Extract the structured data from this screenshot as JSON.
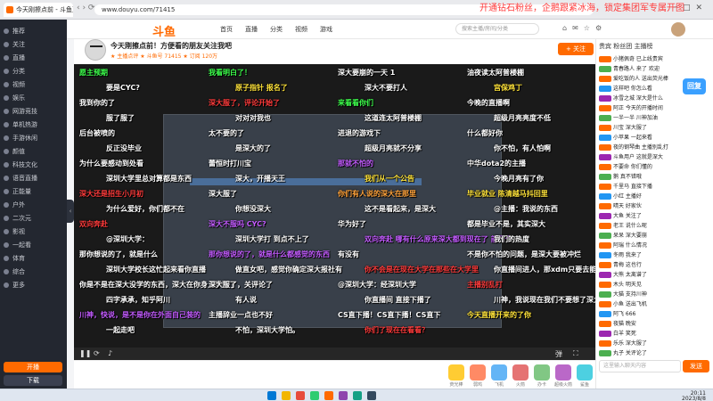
{
  "browser": {
    "tab_title": "今天刚擦点前 - 斗鱼直播",
    "url": "www.douyu.com/71415",
    "overlay_caption": "开通钻石粉丝，企鹅跟紧冰海，锁定集团军专属开图"
  },
  "sidebar": {
    "items": [
      {
        "label": "推荐"
      },
      {
        "label": "关注"
      },
      {
        "label": "直播"
      },
      {
        "label": "分类"
      },
      {
        "label": "视频"
      },
      {
        "label": "娱乐"
      },
      {
        "label": "网游竞技"
      },
      {
        "label": "单机热游"
      },
      {
        "label": "手游休闲"
      },
      {
        "label": "颜值"
      },
      {
        "label": "科技文化"
      },
      {
        "label": "语音直播"
      },
      {
        "label": "正能量"
      },
      {
        "label": "户外"
      },
      {
        "label": "二次元"
      },
      {
        "label": "影视"
      },
      {
        "label": "一起看"
      },
      {
        "label": "体育"
      },
      {
        "label": "综合"
      },
      {
        "label": "更多"
      }
    ],
    "btn_primary": "开播",
    "btn_secondary": "下载"
  },
  "nav": {
    "logo": "斗鱼",
    "links": [
      "首页",
      "直播",
      "分类",
      "视频",
      "游戏"
    ],
    "search_placeholder": "搜索主播/房间/分类"
  },
  "room": {
    "title": "今天刚擦点前！方便看的朋友关注我吧",
    "meta": "★ 主播点评  ★ 斗鱼号 71415  ★ 订阅 120万",
    "follow_label": "+ 关注"
  },
  "danmu": [
    {
      "text": "愿主预期",
      "cls": "c-green"
    },
    {
      "text": "我看明白了！",
      "cls": "c-green"
    },
    {
      "text": "深大要崩的一天 1",
      "cls": "c-white"
    },
    {
      "text": "油夜读太阿普楼棚",
      "cls": "c-white"
    },
    {
      "text": "要是CYC?",
      "cls": "c-white"
    },
    {
      "text": "原子指针 报名了",
      "cls": "c-yellow"
    },
    {
      "text": "深大不要打人",
      "cls": "c-white"
    },
    {
      "text": "宫保鸡丁",
      "cls": "c-yellow"
    },
    {
      "text": "我到你的了",
      "cls": "c-white"
    },
    {
      "text": "深大服了，评论开始了",
      "cls": "c-red"
    },
    {
      "text": "来看看你们",
      "cls": "c-green"
    },
    {
      "text": "今晚的直播啊",
      "cls": "c-white"
    },
    {
      "text": "服了服了",
      "cls": "c-white"
    },
    {
      "text": "对对对我也",
      "cls": "c-white"
    },
    {
      "text": "这道连太阿普楼棚",
      "cls": "c-white"
    },
    {
      "text": "超级月亮亮度不低",
      "cls": "c-white"
    },
    {
      "text": "后台被喷的",
      "cls": "c-white"
    },
    {
      "text": "太不要的了",
      "cls": "c-white"
    },
    {
      "text": "进退的游戏下",
      "cls": "c-white"
    },
    {
      "text": "什么都好你",
      "cls": "c-white"
    },
    {
      "text": "反正没毕业",
      "cls": "c-white"
    },
    {
      "text": "是深大的了",
      "cls": "c-white"
    },
    {
      "text": "超级月亮就不分享",
      "cls": "c-white"
    },
    {
      "text": "你不怕，有人怕啊",
      "cls": "c-white"
    },
    {
      "text": "为什么要感动到处看",
      "cls": "c-white"
    },
    {
      "text": "蕾恒时打川宝",
      "cls": "c-white"
    },
    {
      "text": "那就不怕的",
      "cls": "c-purple"
    },
    {
      "text": "中华dota2的主播",
      "cls": "c-white"
    },
    {
      "text": "深圳大学里总对算都是东西",
      "cls": "c-white"
    },
    {
      "text": "深大，开播天王",
      "cls": "c-white"
    },
    {
      "text": "我们从一个公告",
      "cls": "c-yellow"
    },
    {
      "text": "今晚月亮有了你",
      "cls": "c-white"
    },
    {
      "text": "深大还是招生小月初",
      "cls": "c-red"
    },
    {
      "text": "深大服了",
      "cls": "c-white"
    },
    {
      "text": "你们有人说的深大在那里",
      "cls": "c-orange"
    },
    {
      "text": "毕业就业 陈清越马抖回里",
      "cls": "c-yellow"
    },
    {
      "text": "为什么爱好，你们都不在",
      "cls": "c-white"
    },
    {
      "text": "你想没深大",
      "cls": "c-white"
    },
    {
      "text": "这不是看起来，是深大",
      "cls": "c-white"
    },
    {
      "text": "@主播：我说的东西",
      "cls": "c-white"
    },
    {
      "text": "双向奔赴",
      "cls": "c-red"
    },
    {
      "text": "深大不服吗 CYC?",
      "cls": "c-purple"
    },
    {
      "text": "华为好了",
      "cls": "c-white"
    },
    {
      "text": "都是毕业不是，其实深大",
      "cls": "c-white"
    },
    {
      "text": "@深圳大学：",
      "cls": "c-white"
    },
    {
      "text": "深圳大学打 到点不上了",
      "cls": "c-white"
    },
    {
      "text": "双向奔赴 哪有什么原来深大都到现在了 前几个",
      "cls": "c-purple"
    },
    {
      "text": "我们的热度",
      "cls": "c-white"
    },
    {
      "text": "那你想说的了，就是什么",
      "cls": "c-white"
    },
    {
      "text": "那你想说的了，就是什么都感觉的东西",
      "cls": "c-purple"
    },
    {
      "text": "有没有",
      "cls": "c-white"
    },
    {
      "text": "不是你不怕的问题，是深大要被冲烂",
      "cls": "c-white"
    },
    {
      "text": "深圳大学校长这忙起来看你直播",
      "cls": "c-white"
    },
    {
      "text": "做直女吧，感觉你确定深大报社有",
      "cls": "c-white"
    },
    {
      "text": "你不会是在现在大学在那些在大学里",
      "cls": "c-red"
    },
    {
      "text": "你直播间进人，那xdm只要去能摸了",
      "cls": "c-white"
    },
    {
      "text": "你是不是在深大没学的东西，深大在你身上学到了",
      "cls": "c-white"
    },
    {
      "text": "深大服了，关评论了",
      "cls": "c-white"
    },
    {
      "text": "@深圳大学：经深圳大学",
      "cls": "c-white"
    },
    {
      "text": "主播别乱打",
      "cls": "c-red"
    },
    {
      "text": "四字承承，知乎阿川",
      "cls": "c-white"
    },
    {
      "text": "有人说",
      "cls": "c-white"
    },
    {
      "text": "你直播间 直接下播了",
      "cls": "c-white"
    },
    {
      "text": "川神，我说现在我们不要想了深大，我没在这里",
      "cls": "c-white"
    },
    {
      "text": "川神，快说，是不是你在外面自己装的",
      "cls": "c-purple"
    },
    {
      "text": "主播辞业一点也不好",
      "cls": "c-white"
    },
    {
      "text": "CS直下播！CS直下播！CS直下",
      "cls": "c-white"
    },
    {
      "text": "今天直播开来的了你",
      "cls": "c-yellow"
    },
    {
      "text": "一起走吧",
      "cls": "c-white"
    },
    {
      "text": "不怕，深圳大学怕。",
      "cls": "c-white"
    },
    {
      "text": "你们了现在在看看？",
      "cls": "c-red"
    }
  ],
  "gifts": [
    {
      "label": "荧光棒"
    },
    {
      "label": "弱鸡"
    },
    {
      "label": "飞机"
    },
    {
      "label": "火箭"
    },
    {
      "label": "办卡"
    },
    {
      "label": "超级火箭"
    },
    {
      "label": "鲨鱼"
    }
  ],
  "right_panel": {
    "tabs": "贵宾  粉丝团  主播榜",
    "rows": [
      {
        "text": "小猪佩奇  已上线贵宾",
        "badge": "#ff6a00"
      },
      {
        "text": "青春路人 来了 欢迎",
        "badge": "#4caf50"
      },
      {
        "text": "爱吃饭的人 送出荧光棒",
        "badge": "#ff6a00"
      },
      {
        "text": "这样吧 你怎么看",
        "badge": "#2196f3"
      },
      {
        "text": "冰雪之城 深大是什么",
        "badge": "#9c27b0"
      },
      {
        "text": "阿正 今天的开播时间",
        "badge": "#ff6a00"
      },
      {
        "text": "一半一半 川神加油",
        "badge": "#4caf50"
      },
      {
        "text": "川宝 深大服了",
        "badge": "#ff6a00"
      },
      {
        "text": "小苹果 一起来看",
        "badge": "#2196f3"
      },
      {
        "text": "夜的钢琴曲 主播别乱打",
        "badge": "#ff6a00"
      },
      {
        "text": "斗鱼用户 这就是深大",
        "badge": "#9c27b0"
      },
      {
        "text": "不要命 你们懂的",
        "badge": "#ff6a00"
      },
      {
        "text": "鹅 真不错哦",
        "badge": "#4caf50"
      },
      {
        "text": "千里马 直接下播",
        "badge": "#ff6a00"
      },
      {
        "text": "小红 主播好",
        "badge": "#2196f3"
      },
      {
        "text": "晴天 好家伙",
        "badge": "#ff6a00"
      },
      {
        "text": "大鱼 关注了",
        "badge": "#9c27b0"
      },
      {
        "text": "老王 说什么呢",
        "badge": "#ff6a00"
      },
      {
        "text": "呆呆 深大要崩",
        "badge": "#4caf50"
      },
      {
        "text": "阿瑞 什么情况",
        "badge": "#ff6a00"
      },
      {
        "text": "冬雨 我来了",
        "badge": "#2196f3"
      },
      {
        "text": "青梅 这也行",
        "badge": "#ff6a00"
      },
      {
        "text": "大熊 太离谱了",
        "badge": "#9c27b0"
      },
      {
        "text": "木头 明天见",
        "badge": "#ff6a00"
      },
      {
        "text": "大猫 支持川神",
        "badge": "#4caf50"
      },
      {
        "text": "小鱼 送出飞机",
        "badge": "#ff6a00"
      },
      {
        "text": "阿飞 666",
        "badge": "#2196f3"
      },
      {
        "text": "夜猫 晚安",
        "badge": "#ff6a00"
      },
      {
        "text": "白羊 笑死",
        "badge": "#9c27b0"
      },
      {
        "text": "乐乐 深大服了",
        "badge": "#ff6a00"
      },
      {
        "text": "丸子 关评论了",
        "badge": "#4caf50"
      }
    ],
    "input_placeholder": "这里输入聊天内容",
    "send_label": "发送",
    "float_label": "回复"
  },
  "taskbar": {
    "time": "20:11",
    "date": "2023/8/8"
  },
  "colors": {
    "accent": "#ff6a00",
    "sidebar": "#232730",
    "danmu_bg": "#1a1a1a"
  }
}
